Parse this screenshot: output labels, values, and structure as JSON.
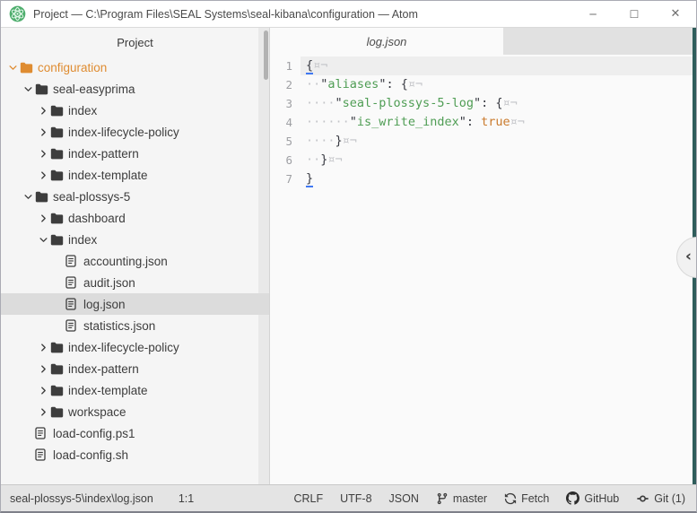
{
  "window": {
    "title": "Project — C:\\Program Files\\SEAL Systems\\seal-kibana\\configuration — Atom",
    "controls": {
      "minimize": "─",
      "maximize": "☐",
      "close": "✕"
    }
  },
  "tree": {
    "header": "Project",
    "items": [
      {
        "label": "configuration",
        "type": "folder",
        "state": "expanded",
        "level": 0,
        "root": true
      },
      {
        "label": "seal-easyprima",
        "type": "folder",
        "state": "expanded",
        "level": 1
      },
      {
        "label": "index",
        "type": "folder",
        "state": "collapsed",
        "level": 2
      },
      {
        "label": "index-lifecycle-policy",
        "type": "folder",
        "state": "collapsed",
        "level": 2
      },
      {
        "label": "index-pattern",
        "type": "folder",
        "state": "collapsed",
        "level": 2
      },
      {
        "label": "index-template",
        "type": "folder",
        "state": "collapsed",
        "level": 2
      },
      {
        "label": "seal-plossys-5",
        "type": "folder",
        "state": "expanded",
        "level": 1
      },
      {
        "label": "dashboard",
        "type": "folder",
        "state": "collapsed",
        "level": 2
      },
      {
        "label": "index",
        "type": "folder",
        "state": "expanded",
        "level": 2
      },
      {
        "label": "accounting.json",
        "type": "file",
        "level": 3
      },
      {
        "label": "audit.json",
        "type": "file",
        "level": 3
      },
      {
        "label": "log.json",
        "type": "file",
        "level": 3,
        "selected": true
      },
      {
        "label": "statistics.json",
        "type": "file",
        "level": 3
      },
      {
        "label": "index-lifecycle-policy",
        "type": "folder",
        "state": "collapsed",
        "level": 2
      },
      {
        "label": "index-pattern",
        "type": "folder",
        "state": "collapsed",
        "level": 2
      },
      {
        "label": "index-template",
        "type": "folder",
        "state": "collapsed",
        "level": 2
      },
      {
        "label": "workspace",
        "type": "folder",
        "state": "collapsed",
        "level": 2
      },
      {
        "label": "load-config.ps1",
        "type": "file",
        "level": 1
      },
      {
        "label": "load-config.sh",
        "type": "file",
        "level": 1
      }
    ]
  },
  "editor": {
    "tab": "log.json",
    "dock_toggle_glyph": "‹",
    "lines": [
      {
        "n": "1",
        "active": true,
        "tok": [
          [
            "b",
            "{"
          ],
          [
            "i",
            "¤¬"
          ]
        ]
      },
      {
        "n": "2",
        "tok": [
          [
            "i",
            "··"
          ],
          [
            "p",
            "\""
          ],
          [
            "k",
            "aliases"
          ],
          [
            "p",
            "\": {"
          ],
          [
            "i",
            "¤¬"
          ]
        ]
      },
      {
        "n": "3",
        "tok": [
          [
            "i",
            "····"
          ],
          [
            "p",
            "\""
          ],
          [
            "k",
            "seal-plossys-5-log"
          ],
          [
            "p",
            "\": {"
          ],
          [
            "i",
            "¤¬"
          ]
        ]
      },
      {
        "n": "4",
        "tok": [
          [
            "i",
            "······"
          ],
          [
            "p",
            "\""
          ],
          [
            "k",
            "is_write_index"
          ],
          [
            "p",
            "\": "
          ],
          [
            "c",
            "true"
          ],
          [
            "i",
            "¤¬"
          ]
        ]
      },
      {
        "n": "5",
        "tok": [
          [
            "i",
            "····"
          ],
          [
            "p",
            "}"
          ],
          [
            "i",
            "¤¬"
          ]
        ]
      },
      {
        "n": "6",
        "tok": [
          [
            "i",
            "··"
          ],
          [
            "p",
            "}"
          ],
          [
            "i",
            "¤¬"
          ]
        ]
      },
      {
        "n": "7",
        "tok": [
          [
            "b",
            "}"
          ]
        ]
      }
    ]
  },
  "status": {
    "path": "seal-plossys-5\\index\\log.json",
    "cursor": "1:1",
    "items": [
      {
        "label": "CRLF"
      },
      {
        "label": "UTF-8"
      },
      {
        "label": "JSON"
      },
      {
        "icon": "git-branch",
        "label": "master"
      },
      {
        "icon": "sync",
        "label": "Fetch"
      },
      {
        "icon": "github",
        "label": "GitHub"
      },
      {
        "icon": "git-commit",
        "label": "Git (1)"
      }
    ]
  },
  "colors": {
    "root_folder": "#df8c31",
    "selection": "#dcdcdc",
    "json_key_green": "#4f9d54",
    "json_const_orange": "#ca7a2c",
    "bracket_match_blue": "#4078f2",
    "dock_edge_teal": "#2f5d5b",
    "atom_logo_green": "#4fae6e"
  }
}
